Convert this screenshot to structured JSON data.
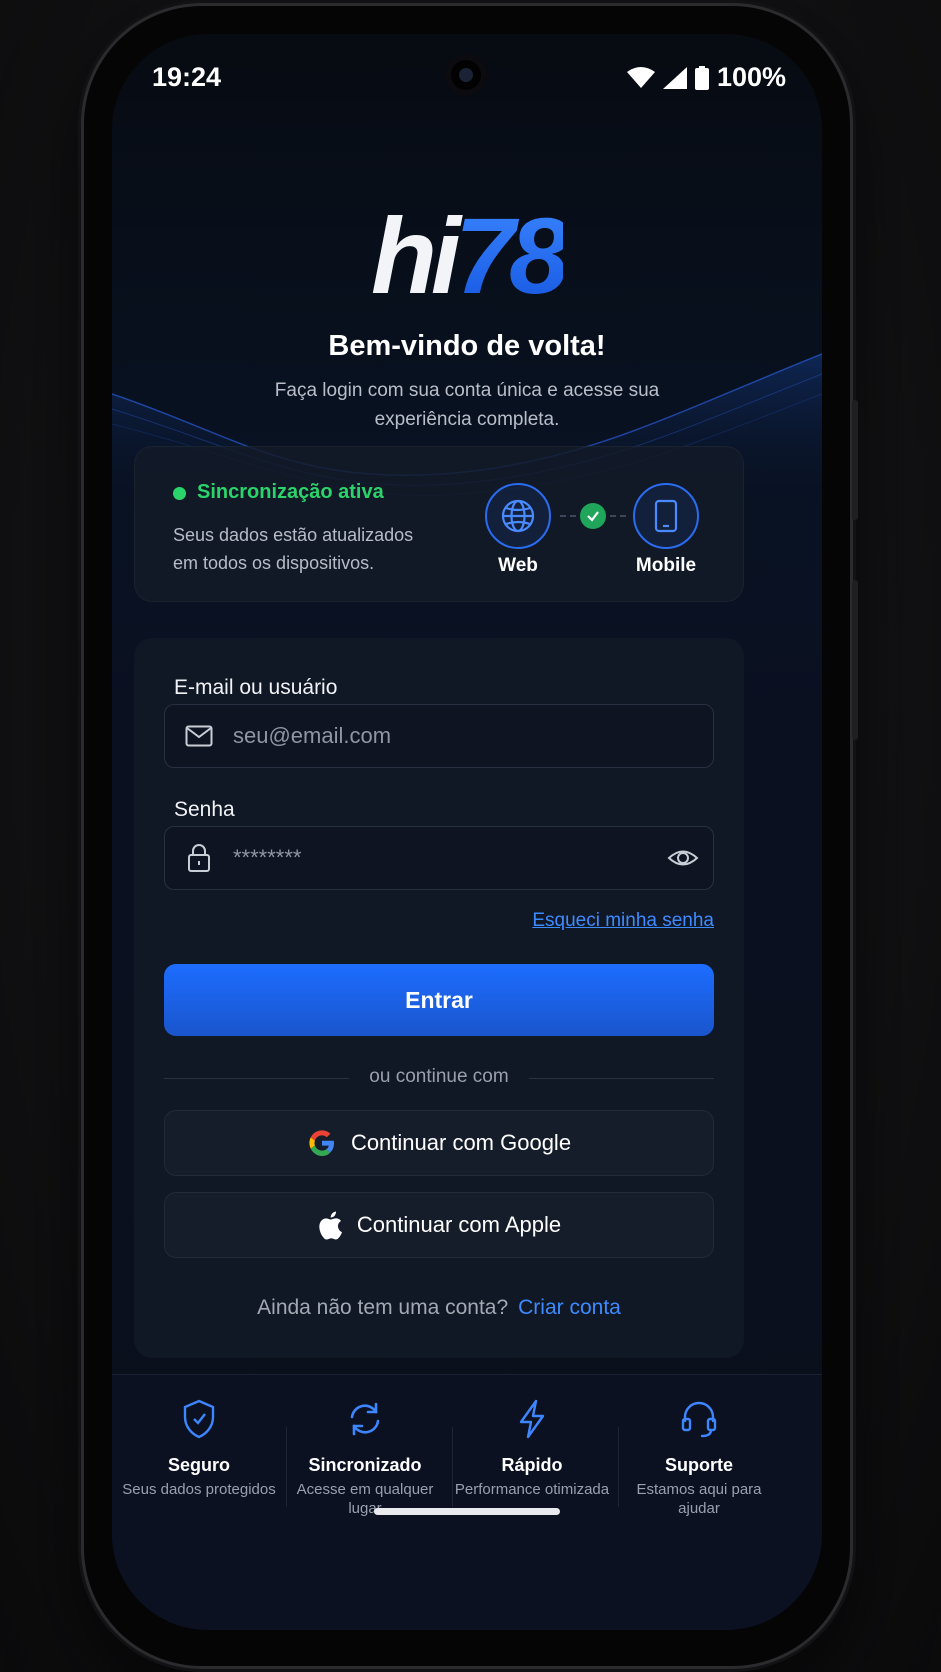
{
  "status_bar": {
    "time": "19:24",
    "battery": "100%"
  },
  "brand": {
    "logo_part1": "hi",
    "logo_part2": "78"
  },
  "header": {
    "title": "Bem-vindo de volta!",
    "subtitle": "Faça login com sua conta única e acesse sua experiência completa."
  },
  "sync": {
    "status": "Sincronização ativa",
    "description": "Seus dados estão atualizados em todos os dispositivos.",
    "device_web": "Web",
    "device_mobile": "Mobile"
  },
  "form": {
    "email_label": "E-mail ou usuário",
    "email_placeholder": "seu@email.com",
    "password_label": "Senha",
    "password_value": "********",
    "forgot": "Esqueci minha senha",
    "submit": "Entrar",
    "divider": "ou continue com",
    "google": "Continuar com Google",
    "apple": "Continuar com Apple",
    "no_account": "Ainda não tem uma conta?",
    "create": "Criar conta"
  },
  "features": [
    {
      "title": "Seguro",
      "desc": "Seus dados protegidos",
      "icon": "shield-icon"
    },
    {
      "title": "Sincronizado",
      "desc": "Acesse em qualquer lugar",
      "icon": "sync-icon"
    },
    {
      "title": "Rápido",
      "desc": "Performance otimizada",
      "icon": "lightning-icon"
    },
    {
      "title": "Suporte",
      "desc": "Estamos aqui para ajudar",
      "icon": "headset-icon"
    }
  ],
  "colors": {
    "accent": "#1f6bff",
    "success": "#2bd46a",
    "background": "#0a1020"
  }
}
